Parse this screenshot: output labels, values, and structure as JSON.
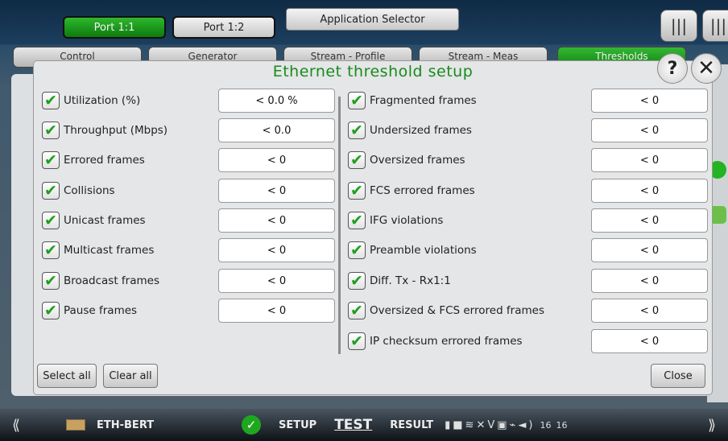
{
  "header": {
    "port_tabs": [
      {
        "label": "Port 1:1",
        "active": true
      },
      {
        "label": "Port 1:2",
        "active": false
      }
    ],
    "app_selector_label": "Application Selector"
  },
  "tabs": [
    "Control",
    "Generator",
    "Stream - Profile",
    "Stream - Meas",
    "Thresholds"
  ],
  "dialog": {
    "title": "Ethernet threshold setup",
    "left_items": [
      {
        "label": "Utilization (%)",
        "value": "< 0.0 %",
        "checked": true
      },
      {
        "label": "Throughput (Mbps)",
        "value": "< 0.0",
        "checked": true
      },
      {
        "label": "Errored frames",
        "value": "< 0",
        "checked": true
      },
      {
        "label": "Collisions",
        "value": "< 0",
        "checked": true
      },
      {
        "label": "Unicast frames",
        "value": "< 0",
        "checked": true
      },
      {
        "label": "Multicast frames",
        "value": "< 0",
        "checked": true
      },
      {
        "label": "Broadcast frames",
        "value": "< 0",
        "checked": true
      },
      {
        "label": "Pause frames",
        "value": "< 0",
        "checked": true
      }
    ],
    "right_items": [
      {
        "label": "Fragmented frames",
        "value": "< 0",
        "checked": true
      },
      {
        "label": "Undersized frames",
        "value": "< 0",
        "checked": true
      },
      {
        "label": "Oversized frames",
        "value": "< 0",
        "checked": true
      },
      {
        "label": "FCS errored frames",
        "value": "< 0",
        "checked": true
      },
      {
        "label": "IFG violations",
        "value": "< 0",
        "checked": true
      },
      {
        "label": "Preamble violations",
        "value": "< 0",
        "checked": true
      },
      {
        "label": "Diff. Tx - Rx1:1",
        "value": "< 0",
        "checked": true
      },
      {
        "label": "Oversized & FCS errored frames",
        "value": "< 0",
        "checked": true
      },
      {
        "label": "IP checksum errored frames",
        "value": "< 0",
        "checked": true
      }
    ],
    "buttons": {
      "select_all": "Select all",
      "clear_all": "Clear all",
      "close": "Close"
    },
    "checkmark_glyph": "✔",
    "help_glyph": "?",
    "close_glyph": "✕"
  },
  "statusbar": {
    "module": "ETH-BERT",
    "setup": "SETUP",
    "test": "TEST",
    "result": "RESULT",
    "time_a": "16",
    "time_b": "16"
  },
  "colors": {
    "title_green": "#1a8a1a",
    "check_green": "#1f9e1f",
    "active_port": "#1f9a1f"
  }
}
